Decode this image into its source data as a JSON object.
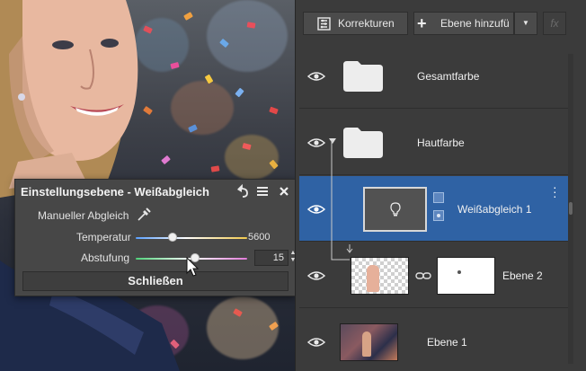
{
  "dialog": {
    "title": "Einstellungsebene - Weißabgleich",
    "manual_label": "Manueller Abgleich",
    "temperature_label": "Temperatur",
    "temperature_value": "5600",
    "temperature_level": 0.33,
    "tint_label": "Abstufung",
    "tint_value": "15",
    "tint_level": 0.53,
    "close_label": "Schließen",
    "icons": [
      "reset-icon",
      "menu-icon",
      "close-icon",
      "eyedropper-icon"
    ]
  },
  "toolbar": {
    "corrections_label": "Korrekturen",
    "add_layer_label": "Ebene hinzufü",
    "fx_label": "fx"
  },
  "layers": [
    {
      "name": "Gesamtfarbe",
      "type": "folder",
      "visible": true
    },
    {
      "name": "Hautfarbe",
      "type": "folder",
      "visible": true,
      "expanded": true
    },
    {
      "name": "Weißabgleich 1",
      "type": "adjustment",
      "visible": true,
      "selected": true
    },
    {
      "name": "Ebene 2",
      "type": "image-with-mask",
      "visible": true
    },
    {
      "name": "Ebene 1",
      "type": "image",
      "visible": true
    }
  ],
  "colors": {
    "selection": "#2f62a4",
    "panel_bg": "#3b3b3b",
    "dialog_bg": "#474747"
  }
}
